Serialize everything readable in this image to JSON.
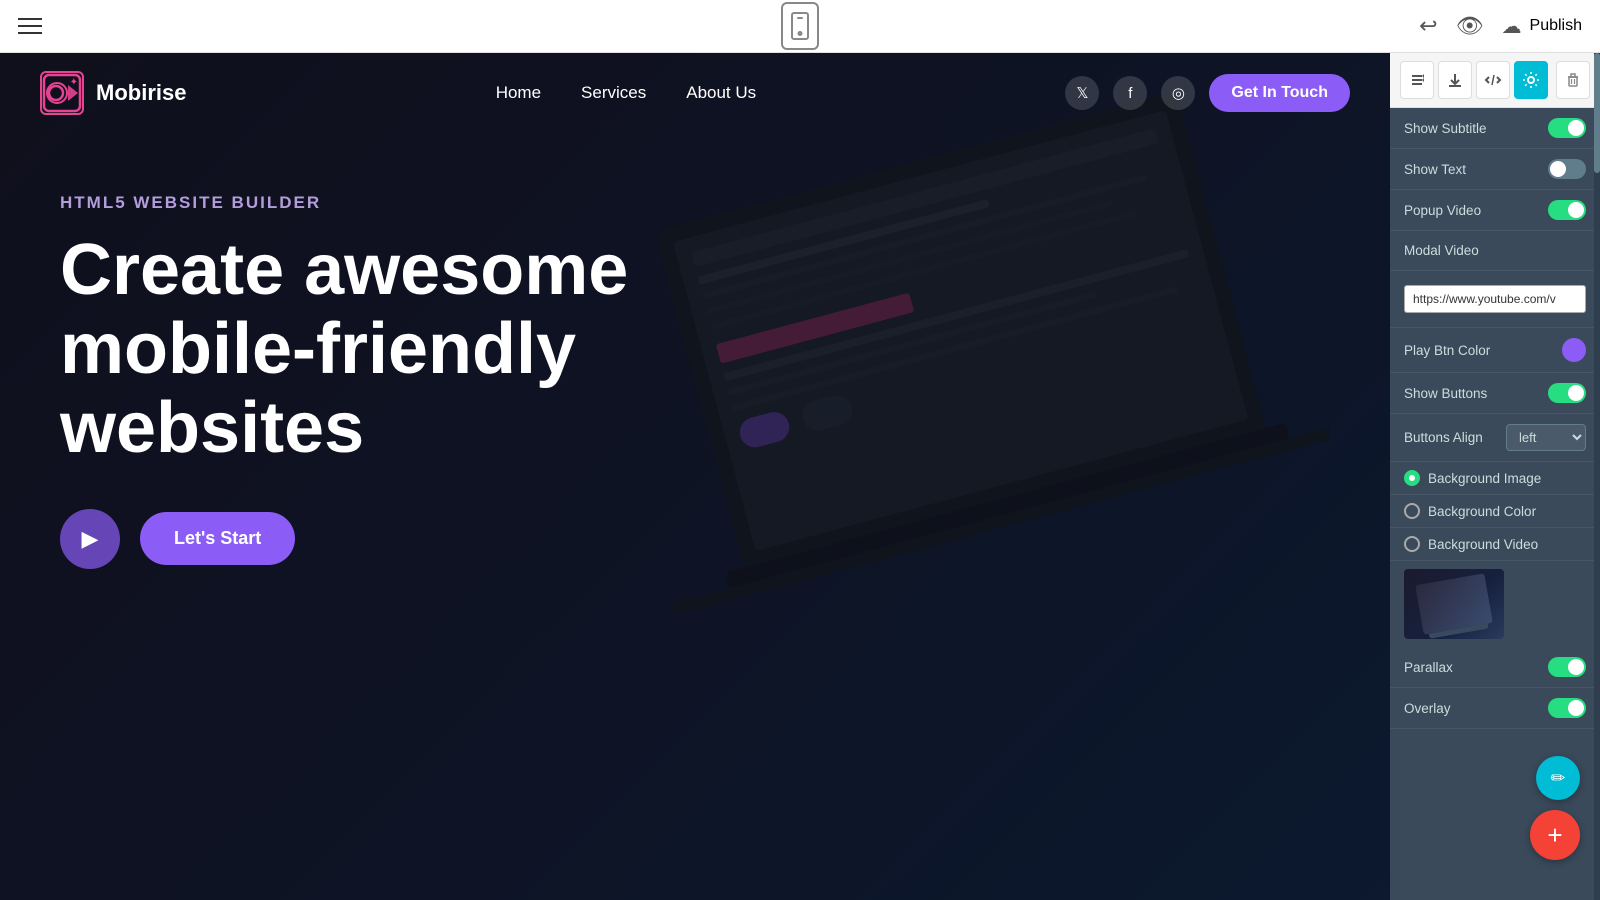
{
  "toolbar": {
    "publish_label": "Publish",
    "phone_icon": "phone-icon",
    "hamburger_icon": "menu-icon",
    "undo_icon": "undo-icon",
    "eye_icon": "preview-icon",
    "cloud_icon": "cloud-upload-icon"
  },
  "hero": {
    "subtitle": "HTML5 WEBSITE BUILDER",
    "title_line1": "Create awesome",
    "title_line2": "mobile-friendly websites",
    "play_button": "play",
    "lets_start_label": "Let's Start"
  },
  "nav": {
    "logo_text": "Mobirise",
    "home_label": "Home",
    "services_label": "Services",
    "about_label": "About Us",
    "cta_label": "Get In Touch"
  },
  "settings_panel": {
    "rows": [
      {
        "id": "show_subtitle",
        "label": "Show Subtitle",
        "type": "toggle",
        "state": "on"
      },
      {
        "id": "show_text",
        "label": "Show Text",
        "type": "toggle",
        "state": "off"
      },
      {
        "id": "popup_video",
        "label": "Popup Video",
        "type": "toggle",
        "state": "on"
      },
      {
        "id": "modal_video_label",
        "label": "Modal Video",
        "type": "label_only"
      },
      {
        "id": "modal_video_url",
        "label": "",
        "type": "input",
        "value": "https://www.youtube.com/v"
      },
      {
        "id": "play_btn_color",
        "label": "Play Btn Color",
        "type": "color",
        "color": "#8b5cf6"
      },
      {
        "id": "show_buttons",
        "label": "Show Buttons",
        "type": "toggle",
        "state": "on"
      },
      {
        "id": "buttons_align",
        "label": "Buttons Align",
        "type": "select",
        "value": "left"
      }
    ],
    "bg_options": [
      {
        "id": "bg_image",
        "label": "Background Image",
        "selected": true
      },
      {
        "id": "bg_color",
        "label": "Background Color",
        "selected": false
      },
      {
        "id": "bg_video",
        "label": "Background Video",
        "selected": false
      }
    ],
    "extra_rows": [
      {
        "id": "parallax",
        "label": "Parallax",
        "type": "toggle",
        "state": "on"
      },
      {
        "id": "overlay",
        "label": "Overlay",
        "type": "toggle",
        "state": "on"
      }
    ]
  },
  "panel_tools": [
    {
      "id": "sort",
      "icon": "↕",
      "active": false
    },
    {
      "id": "download",
      "icon": "↓",
      "active": false
    },
    {
      "id": "code",
      "icon": "</>",
      "active": false
    },
    {
      "id": "settings",
      "icon": "⚙",
      "active": true
    },
    {
      "id": "delete",
      "icon": "🗑",
      "active": false
    }
  ],
  "fabs": {
    "pencil_icon": "pencil-icon",
    "add_icon": "add-icon"
  }
}
